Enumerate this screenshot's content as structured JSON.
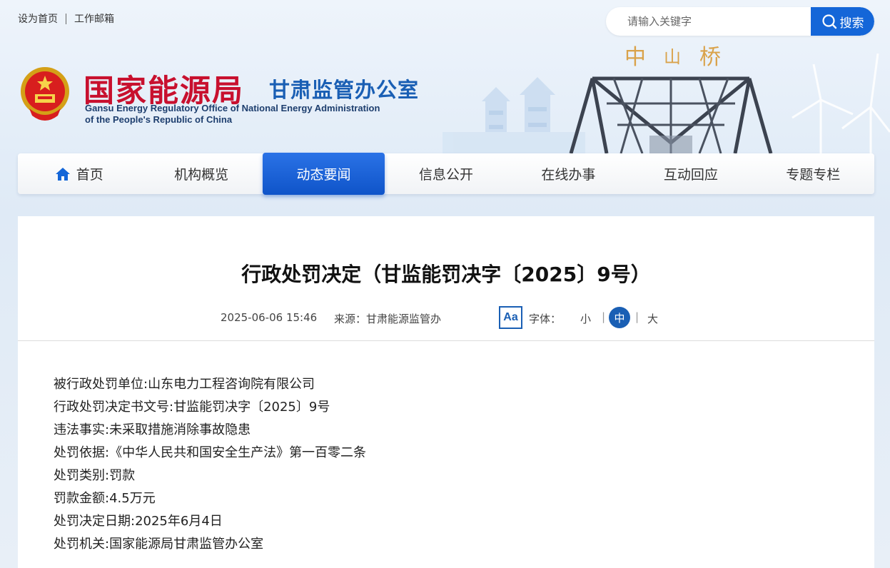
{
  "top_links": [
    "设为首页",
    "工作邮箱"
  ],
  "search": {
    "placeholder": "请输入关键字",
    "button_label": "搜索"
  },
  "header": {
    "org_name": "国家能源局",
    "org_sub": "甘肃监管办公室",
    "org_en_line1": "Gansu Energy Regulatory Office of National Energy Administration",
    "org_en_line2": "of the People's Republic of China"
  },
  "nav": [
    {
      "label": "首页",
      "active": false,
      "icon": "home-icon"
    },
    {
      "label": "机构概览",
      "active": false
    },
    {
      "label": "动态要闻",
      "active": true
    },
    {
      "label": "信息公开",
      "active": false
    },
    {
      "label": "在线办事",
      "active": false
    },
    {
      "label": "互动回应",
      "active": false
    },
    {
      "label": "专题专栏",
      "active": false
    }
  ],
  "article": {
    "title": "行政处罚决定（甘监能罚决字〔2025〕9号）",
    "date": "2025-06-06 15:46",
    "source": "来源：甘肃能源监管办",
    "font_icon": "Aa",
    "font_label": "字体：",
    "sizes": {
      "small": "小",
      "medium": "中",
      "large": "大",
      "selected": "medium"
    },
    "paragraphs": [
      "被行政处罚单位:山东电力工程咨询院有限公司",
      "行政处罚决定书文号:甘监能罚决字〔2025〕9号",
      "违法事实:未采取措施消除事故隐患",
      "处罚依据:《中华人民共和国安全生产法》第一百零二条",
      "处罚类别:罚款",
      "罚款金额:4.5万元",
      "处罚决定日期:2025年6月4日",
      "处罚机关:国家能源局甘肃监管办公室"
    ]
  },
  "colors": {
    "brand_blue": "#1466d8",
    "title_red": "#c8102e",
    "nav_active": "#0f54c9"
  }
}
